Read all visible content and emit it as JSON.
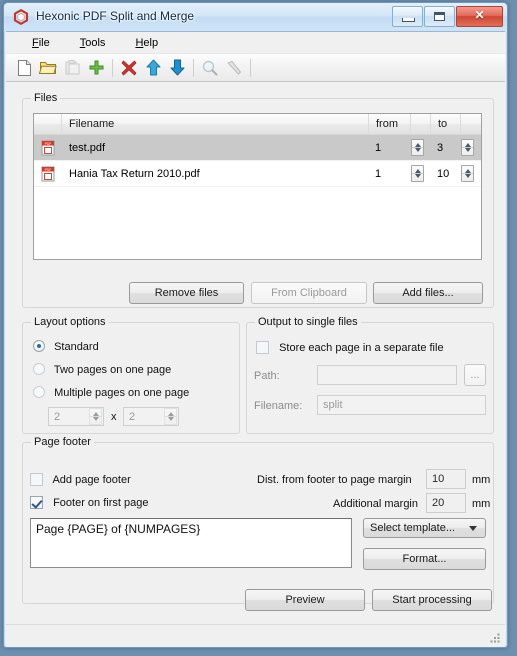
{
  "window": {
    "title": "Hexonic PDF Split and Merge",
    "app_icon": "hexagon-logo",
    "controls": {
      "minimize": "minimize-icon",
      "maximize": "maximize-icon",
      "close": "✕"
    }
  },
  "menu": [
    {
      "accel": "F",
      "rest": "ile"
    },
    {
      "accel": "T",
      "rest": "ools"
    },
    {
      "accel": "H",
      "rest": "elp"
    }
  ],
  "toolbar": [
    {
      "name": "new-document-icon",
      "enabled": true
    },
    {
      "name": "open-folder-icon",
      "enabled": true
    },
    {
      "name": "paste-clipboard-icon",
      "enabled": false
    },
    {
      "name": "add-plus-icon",
      "enabled": true
    },
    {
      "name": "delete-x-icon",
      "enabled": true
    },
    {
      "name": "move-up-icon",
      "enabled": true
    },
    {
      "name": "move-down-icon",
      "enabled": true
    },
    {
      "name": "preview-magnifier-icon",
      "enabled": false
    },
    {
      "name": "tools-hammer-icon",
      "enabled": false
    }
  ],
  "files": {
    "group_title": "Files",
    "columns": [
      "",
      "Filename",
      "from",
      "to"
    ],
    "rows": [
      {
        "icon": "pdf-file-icon",
        "filename": "test.pdf",
        "from": "1",
        "to": "3",
        "selected": true
      },
      {
        "icon": "pdf-file-icon",
        "filename": "Hania Tax Return 2010.pdf",
        "from": "1",
        "to": "10",
        "selected": false
      }
    ],
    "buttons": {
      "remove": "Remove files",
      "clipboard": "From Clipboard",
      "add": "Add files..."
    }
  },
  "layout_options": {
    "group_title": "Layout options",
    "options": [
      {
        "label": "Standard",
        "selected": true
      },
      {
        "label": "Two pages on one page",
        "selected": false
      },
      {
        "label": "Multiple pages on one page",
        "selected": false
      }
    ],
    "grid": {
      "rows": "2",
      "cols": "2",
      "separator": "x"
    }
  },
  "output": {
    "group_title": "Output to single files",
    "store_each_page": {
      "label": "Store each page in a separate file",
      "checked": false
    },
    "path": {
      "label": "Path:",
      "value": ""
    },
    "browse": "...",
    "filename": {
      "label": "Filename:",
      "value": "split"
    }
  },
  "page_footer": {
    "group_title": "Page footer",
    "add_page_footer": {
      "label": "Add page footer",
      "checked": false
    },
    "footer_on_first_page": {
      "label": "Footer on first page",
      "checked": true
    },
    "dist_label": "Dist. from footer to page margin",
    "dist_value": "10",
    "dist_unit": "mm",
    "additional_label": "Additional margin",
    "additional_value": "20",
    "additional_unit": "mm",
    "template_text": "Page {PAGE} of {NUMPAGES}",
    "select_template": "Select template...",
    "format_button": "Format..."
  },
  "actions": {
    "preview": "Preview",
    "start": "Start processing"
  },
  "statusbar": {
    "text": "",
    "grip": "resize-grip"
  },
  "colors": {
    "accent": "#2a6ca8",
    "close_red": "#cf4632",
    "selection": "#c9c9c9",
    "pdf_red": "#d03a2a"
  }
}
